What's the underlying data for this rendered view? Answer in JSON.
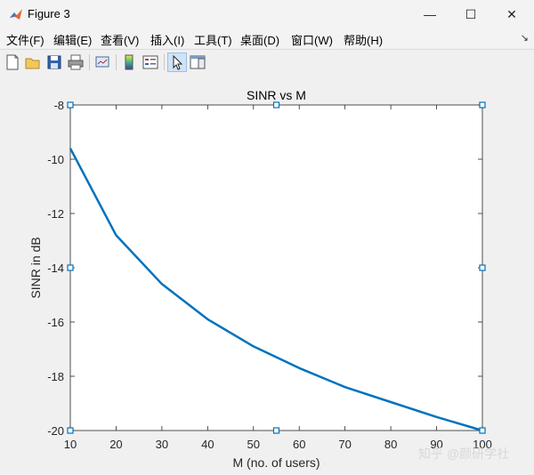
{
  "window": {
    "title": "Figure 3",
    "minimize_glyph": "—",
    "maximize_glyph": "☐",
    "close_glyph": "✕"
  },
  "menu": {
    "items": [
      "文件(F)",
      "编辑(E)",
      "查看(V)",
      "插入(I)",
      "工具(T)",
      "桌面(D)",
      "窗口(W)",
      "帮助(H)"
    ],
    "overflow_glyph": "↘"
  },
  "toolbar": {
    "icons": [
      "new-figure-icon",
      "open-file-icon",
      "save-icon",
      "print-icon",
      "link-plot-icon",
      "insert-colorbar-icon",
      "insert-legend-icon",
      "pointer-icon",
      "property-inspector-icon"
    ],
    "active": "pointer-icon"
  },
  "colors": {
    "line": "#0072bd",
    "handle": "#0072bd"
  },
  "chart_data": {
    "type": "line",
    "title": "SINR vs M",
    "xlabel": "M (no. of users)",
    "ylabel": "SINR in dB",
    "xlim": [
      10,
      100
    ],
    "ylim": [
      -20,
      -8
    ],
    "xticks": [
      10,
      20,
      30,
      40,
      50,
      60,
      70,
      80,
      90,
      100
    ],
    "yticks": [
      -8,
      -10,
      -12,
      -14,
      -16,
      -18,
      -20
    ],
    "grid": false,
    "series": [
      {
        "x": [
          10,
          20,
          30,
          40,
          50,
          60,
          70,
          80,
          90,
          100
        ],
        "y": [
          -9.6,
          -12.8,
          -14.6,
          -15.9,
          -16.9,
          -17.7,
          -18.4,
          -18.95,
          -19.5,
          -20.0
        ]
      }
    ]
  },
  "watermark": "知乎 @颜研学社"
}
